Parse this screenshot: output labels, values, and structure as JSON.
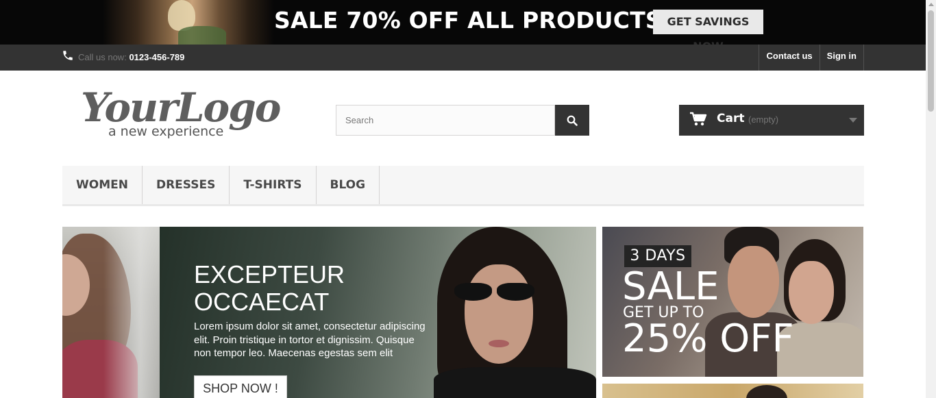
{
  "promo_banner": {
    "headline": "SALE 70% OFF ALL PRODUCTS",
    "cta_label": "GET SAVINGS NOW"
  },
  "top_bar": {
    "call_prefix": "Call us now:",
    "phone_number": "0123-456-789",
    "links": [
      "Contact us",
      "Sign in"
    ]
  },
  "logo": {
    "wordmark": "YourLogo",
    "tagline": "a new experience"
  },
  "search": {
    "placeholder": "Search",
    "value": "",
    "icon": "search-icon"
  },
  "cart": {
    "label": "Cart",
    "status": "(empty)",
    "icon": "shopping-cart-icon"
  },
  "menu": {
    "items": [
      "WOMEN",
      "DRESSES",
      "T-SHIRTS",
      "BLOG"
    ]
  },
  "hero": {
    "title_line1": "EXCEPTEUR",
    "title_line2": "OCCAECAT",
    "text": "Lorem ipsum dolor sit amet, consectetur adipiscing elit. Proin tristique in tortor et dignissim. Quisque non tempor leo. Maecenas egestas sem elit",
    "button_label": "SHOP NOW !"
  },
  "side_banner": {
    "badge": "3 DAYS",
    "headline": "SALE",
    "subline": "GET UP TO",
    "discount": "25% OFF"
  },
  "colors": {
    "dark_bar": "#333333",
    "promo_bg": "#070707",
    "menu_bg": "#f6f6f6",
    "text_dark": "#484848"
  }
}
